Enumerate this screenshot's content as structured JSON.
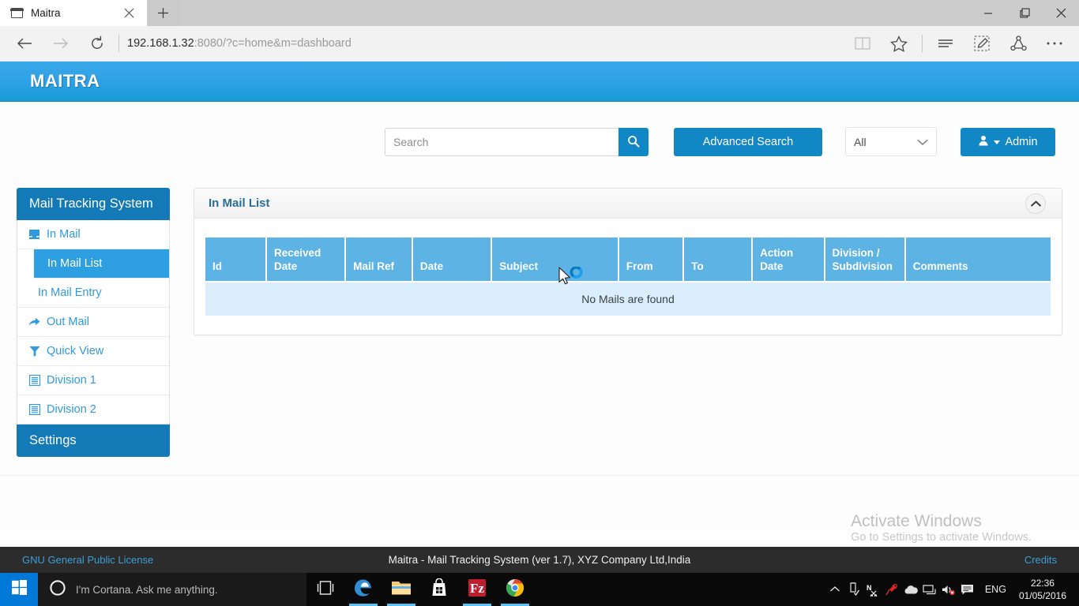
{
  "browser": {
    "tab": {
      "title": "Maitra",
      "favicon": "page-icon",
      "close": "×"
    },
    "newtab_label": "+",
    "window_controls": {
      "minimize": "−",
      "maximize": "❐",
      "close": "✕"
    },
    "nav": {
      "back": "back-arrow-icon",
      "forward": "forward-arrow-icon",
      "refresh": "refresh-icon",
      "url_host": "192.168.1.32",
      "url_rest": ":8080/?c=home&m=dashboard",
      "reading_view": "book-icon",
      "favorite": "star-icon",
      "hub": "hub-icon",
      "web_note": "web-note-icon",
      "share": "share-icon",
      "more": "more-icon"
    }
  },
  "appbar": {
    "brand": "MAITRA",
    "search": {
      "placeholder": "Search",
      "value": "",
      "button_icon": "search-icon"
    },
    "advanced_search_label": "Advanced Search",
    "scope": {
      "selected": "All",
      "options": [
        "All"
      ]
    },
    "user": {
      "label": "Admin",
      "icon": "user-icon"
    }
  },
  "sidebar": {
    "title": "Mail Tracking System",
    "items": [
      {
        "label": "In Mail",
        "icon": "inbox-icon"
      },
      {
        "label": "In Mail List",
        "sub": true,
        "active": true
      },
      {
        "label": "In Mail Entry",
        "sub": true,
        "active": false
      },
      {
        "label": "Out Mail",
        "icon": "share-arrow-icon"
      },
      {
        "label": "Quick View",
        "icon": "filter-icon"
      },
      {
        "label": "Division 1",
        "icon": "list-icon"
      },
      {
        "label": "Division 2",
        "icon": "list-icon"
      }
    ],
    "footer_label": "Settings"
  },
  "panel": {
    "title": "In Mail List",
    "collapse_icon": "chevron-up-icon",
    "table": {
      "columns": [
        "Id",
        "Received Date",
        "Mail Ref",
        "Date",
        "Subject",
        "From",
        "To",
        "Action Date",
        "Division / Subdivision",
        "Comments"
      ],
      "rows": [],
      "empty_message": "No Mails are found"
    }
  },
  "watermark": {
    "line1": "Activate Windows",
    "line2": "Go to Settings to activate Windows."
  },
  "footer": {
    "license": "GNU General Public License",
    "center": "Maitra - Mail Tracking System (ver 1.7), XYZ Company Ltd,India",
    "credits": "Credits"
  },
  "taskbar": {
    "start": "windows-logo-icon",
    "cortana_placeholder": "I'm Cortana. Ask me anything.",
    "cortana_icon": "cortana-circle-icon",
    "taskview": "task-view-icon",
    "apps": [
      {
        "name": "edge-icon",
        "active": true
      },
      {
        "name": "file-explorer-icon",
        "active": true
      },
      {
        "name": "store-icon",
        "active": false
      },
      {
        "name": "filezilla-icon",
        "active": true
      },
      {
        "name": "chrome-icon",
        "active": true
      }
    ],
    "tray": [
      "show-hidden-icons-icon",
      "usb-eject-icon",
      "onenote-clipper-icon",
      "red-pin-icon",
      "onedrive-icon",
      "network-icon",
      "volume-muted-icon",
      "action-center-icon"
    ],
    "language": "ENG",
    "time": "22:36",
    "date": "01/05/2016"
  },
  "colors": {
    "brand_blue": "#2ea1e6",
    "dark_blue": "#1479b7",
    "accent_blue": "#1287c6",
    "table_header": "#5cb3e4",
    "table_empty": "#dbeefb",
    "link_blue": "#2f9ade"
  }
}
